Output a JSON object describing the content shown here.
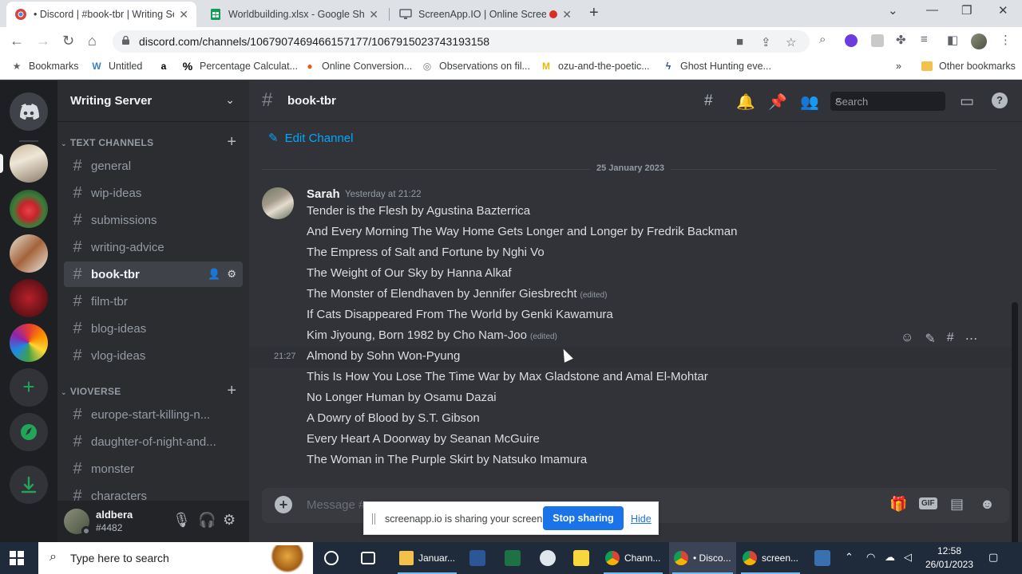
{
  "browser": {
    "tabs": [
      {
        "title": "• Discord | #book-tbr | Writing Se",
        "active": true
      },
      {
        "title": "Worldbuilding.xlsx - Google Shee",
        "active": false
      },
      {
        "title": "ScreenApp.IO | Online Screen",
        "active": false
      }
    ],
    "url": "discord.com/channels/1067907469466157177/1067915023743193158",
    "bookmarks": [
      {
        "label": "Bookmarks",
        "icon": "star-icon"
      },
      {
        "label": "Untitled",
        "icon": "w-icon"
      },
      {
        "label": "",
        "icon": "amazon-icon"
      },
      {
        "label": "Percentage Calculat...",
        "icon": "percent-icon"
      },
      {
        "label": "Online Conversion...",
        "icon": "conversion-icon"
      },
      {
        "label": "Observations on fil...",
        "icon": "film-icon"
      },
      {
        "label": "ozu-and-the-poetic...",
        "icon": "m-icon"
      },
      {
        "label": "Ghost Hunting eve...",
        "icon": "ghost-icon"
      }
    ],
    "other_bookmarks": "Other bookmarks",
    "more": "»"
  },
  "discord": {
    "server_name": "Writing Server",
    "categories": [
      {
        "name": "TEXT CHANNELS"
      },
      {
        "name": "VIOVERSE"
      }
    ],
    "text_channels": [
      "general",
      "wip-ideas",
      "submissions",
      "writing-advice",
      "book-tbr",
      "film-tbr",
      "blog-ideas",
      "vlog-ideas"
    ],
    "vioverse_channels": [
      "europe-start-killing-n...",
      "daughter-of-night-and...",
      "monster",
      "characters"
    ],
    "user": {
      "name": "aldbera",
      "tag": "#4482"
    },
    "channel": {
      "name": "book-tbr",
      "edit_label": "Edit Channel"
    },
    "search_placeholder": "Search",
    "date_divider": "25 January 2023",
    "message": {
      "author": "Sarah",
      "timestamp": "Yesterday at 21:22",
      "hover_time": "21:27",
      "lines": [
        {
          "text": "Tender is the Flesh by Agustina Bazterrica",
          "edited": ""
        },
        {
          "text": "And Every Morning The Way Home Gets Longer and Longer by Fredrik Backman",
          "edited": ""
        },
        {
          "text": "The Empress of Salt and Fortune by Nghi Vo",
          "edited": ""
        },
        {
          "text": "The Weight of Our Sky by Hanna Alkaf",
          "edited": ""
        },
        {
          "text": "The Monster of Elendhaven by Jennifer Giesbrecht",
          "edited": "(edited)"
        },
        {
          "text": "If Cats Disappeared From The World by Genki Kawamura",
          "edited": ""
        },
        {
          "text": "Kim Jiyoung, Born 1982 by Cho Nam-Joo",
          "edited": "(edited)"
        },
        {
          "text": "Almond by Sohn Won-Pyung",
          "edited": ""
        },
        {
          "text": "This Is How You Lose The Time War by Max Gladstone and Amal El-Mohtar",
          "edited": ""
        },
        {
          "text": "No Longer Human by Osamu Dazai",
          "edited": ""
        },
        {
          "text": "A Dowry of Blood by S.T. Gibson",
          "edited": ""
        },
        {
          "text": "Every Heart A Doorway by Seanan McGuire",
          "edited": ""
        },
        {
          "text": "The Woman in The Purple Skirt by Natsuko Imamura",
          "edited": ""
        }
      ]
    },
    "composer_placeholder": "Message #",
    "gif_label": "GIF"
  },
  "share_banner": {
    "text": "screenapp.io is sharing your screen.",
    "stop": "Stop sharing",
    "hide": "Hide"
  },
  "taskbar": {
    "search_placeholder": "Type here to search",
    "apps": [
      {
        "label": "Januar...",
        "icon": "folder-icon"
      },
      {
        "label": "Chann...",
        "icon": "chrome-icon"
      },
      {
        "label": "• Disco...",
        "icon": "chrome-icon"
      },
      {
        "label": "screen...",
        "icon": "chrome-icon"
      }
    ],
    "time": "12:58",
    "date": "26/01/2023"
  },
  "colors": {
    "discord_bg": "#313338",
    "sidebar_bg": "#2b2d31",
    "guild_bg": "#1e1f22",
    "link_blue": "#00a8fc",
    "green": "#23a559",
    "stop_blue": "#1a73e8"
  }
}
